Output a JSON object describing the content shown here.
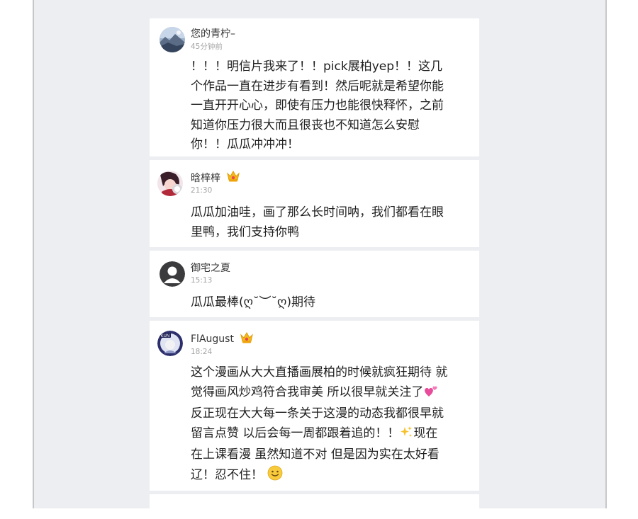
{
  "comments": [
    {
      "username": "您的青柠–",
      "time": "45分钟前",
      "avatar": "landscape-avatar",
      "badge": null,
      "text": "！！！明信片我来了！！pick展柏yep！！这几\n个作品一直在进步有看到！然后呢就是希望你能\n一直开开心心，即使有压力也能很快释怀，之前\n知道你压力很大而且很丧也不知道怎么安慰\n你！！瓜瓜冲冲冲！"
    },
    {
      "username": "晗梓梓",
      "time": "21:30",
      "avatar": "anime-character-avatar",
      "badge": "crown-badge-icon",
      "text": "瓜瓜加油哇，画了那么长时间呐，我们都看在眼\n里鸭，我们支持你鸭"
    },
    {
      "username": "御宅之夏",
      "time": "15:13",
      "avatar": "default-user-avatar",
      "badge": null,
      "text": "瓜瓜最棒(ღ˘︶˘ღ)期待"
    },
    {
      "username": "FlAugust",
      "time": "18:24",
      "avatar": "kun-badge-avatar",
      "badge": "crown-badge-icon",
      "text_lines": [
        "这个漫画从大大直播画展柏的时候就疯狂期待 就",
        "觉得画风炒鸡符合我审美 所以很早就关注了",
        "反正现在大大每一条关于这漫的动态我都很早就",
        "留言点赞 以后会每一周都跟着追的！！",
        "现在",
        "在上课看漫 虽然知道不对 但是因为实在太好看",
        "辽！忍不住！"
      ],
      "inline_emojis": [
        "two-hearts-emoji",
        "sparkles-emoji",
        "smile-emoji"
      ]
    }
  ],
  "colors": {
    "page_background": "#eceef1",
    "card_background": "#ffffff",
    "username": "#333333",
    "timestamp": "#a4a4a4",
    "text": "#1f1f1f"
  }
}
